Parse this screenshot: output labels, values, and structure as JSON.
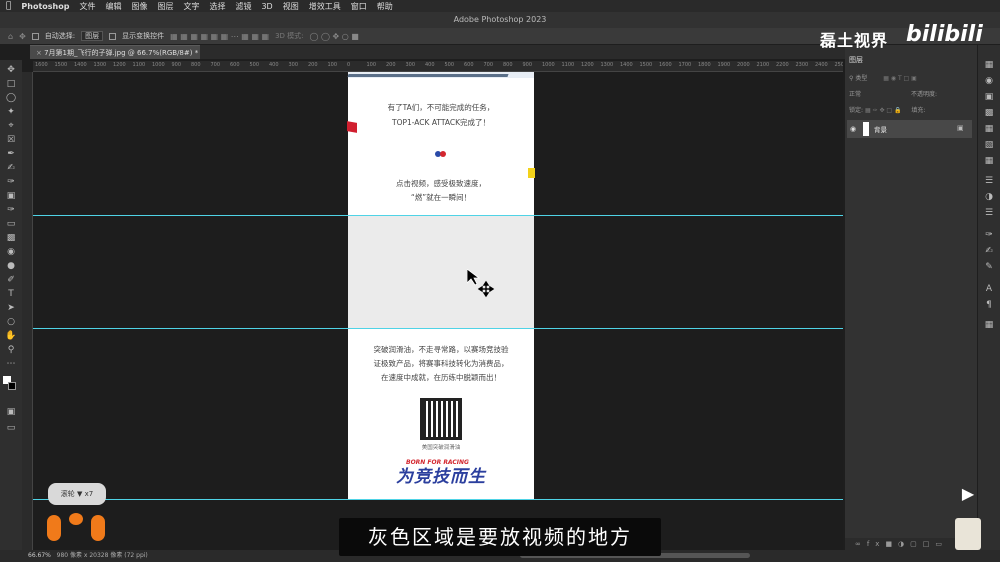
{
  "menubar": {
    "app": "Photoshop",
    "items": [
      "文件",
      "编辑",
      "图像",
      "图层",
      "文字",
      "选择",
      "滤镜",
      "3D",
      "视图",
      "增效工具",
      "窗口",
      "帮助"
    ]
  },
  "window": {
    "title": "Adobe Photoshop 2023"
  },
  "options": {
    "auto_select_label": "自动选择:",
    "auto_select_value": "图层",
    "show_transform_label": "显示变换控件",
    "mode_3d": "3D 模式:"
  },
  "document": {
    "tab_label": "7月第1期_飞行的子弹.jpg @ 66.7%(RGB/8#) *"
  },
  "ruler": {
    "ticks": [
      "1600",
      "1500",
      "1400",
      "1300",
      "1200",
      "1100",
      "1000",
      "900",
      "800",
      "700",
      "600",
      "500",
      "400",
      "300",
      "200",
      "100",
      "0",
      "100",
      "200",
      "300",
      "400",
      "500",
      "600",
      "700",
      "800",
      "900",
      "1000",
      "1100",
      "1200",
      "1300",
      "1400",
      "1500",
      "1600",
      "1700",
      "1800",
      "1900",
      "2000",
      "2100",
      "2200",
      "2300",
      "2400",
      "2500"
    ]
  },
  "page_content": {
    "para1_line1": "有了TA们，不可能完成的任务，",
    "para1_line2": "TOP1-ACK ATTACK完成了！",
    "para2_line1": "点击视频，感受极致速度，",
    "para2_line2": "“燃”就在一瞬间！",
    "para3_line1": "突破润滑油，不走寻常路，以赛场竞技验",
    "para3_line2": "证极致产品，将赛事科技转化为消费品，",
    "para3_line3": "在速度中成就，在历练中脱颖而出！",
    "qr_label": "美国突破润滑油",
    "logo_main": "为竞技而生",
    "logo_sub": "BORN FOR RACING"
  },
  "layers_panel": {
    "title": "图层",
    "filter": "类型",
    "blend_mode": "正常",
    "opacity_label": "不透明度:",
    "lock_label": "锁定:",
    "fill_label": "填充:",
    "layer_name": "背景"
  },
  "status": {
    "zoom": "66.67%",
    "doc_info": "980 像素 x 20328 像素 (72 ppi)"
  },
  "overlay": {
    "watermark": "磊土视界",
    "bilibili": "bilibili",
    "scroll_hint": "滚轮 ▼ x7",
    "subtitle": "灰色区域是要放视频的地方"
  },
  "colors": {
    "guide": "#4fd3e6",
    "gray_zone": "#ebebeb",
    "logo_blue": "#2b3f9e",
    "logo_red": "#d3262e",
    "accent_orange": "#f07a1a"
  }
}
